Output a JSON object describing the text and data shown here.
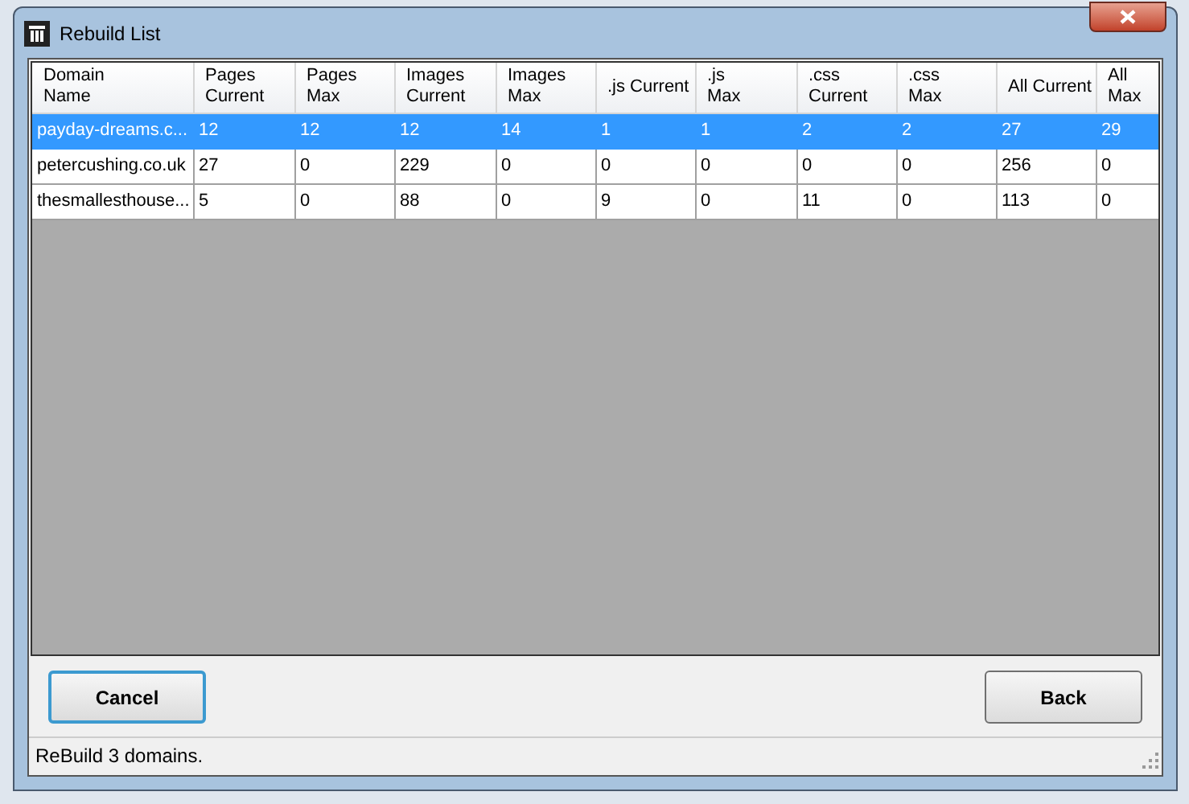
{
  "window": {
    "title": "Rebuild List"
  },
  "table": {
    "columns": [
      "Domain\nName",
      "Pages\nCurrent",
      "Pages\nMax",
      "Images\nCurrent",
      "Images\nMax",
      ".js Current",
      ".js\nMax",
      ".css\nCurrent",
      ".css\nMax",
      "All Current",
      "All\nMax"
    ],
    "rows": [
      {
        "selected": true,
        "cells": [
          "payday-dreams.c...",
          "12",
          "12",
          "12",
          "14",
          "1",
          "1",
          "2",
          "2",
          "27",
          "29"
        ]
      },
      {
        "selected": false,
        "cells": [
          "petercushing.co.uk",
          "27",
          "0",
          "229",
          "0",
          "0",
          "0",
          "0",
          "0",
          "256",
          "0"
        ]
      },
      {
        "selected": false,
        "cells": [
          "thesmallesthouse...",
          "5",
          "0",
          "88",
          "0",
          "9",
          "0",
          "11",
          "0",
          "113",
          "0"
        ]
      }
    ]
  },
  "buttons": [
    {
      "label": "Cancel",
      "focused": true
    },
    {
      "label": "Back",
      "focused": false
    }
  ],
  "status_bar": "ReBuild 3 domains."
}
